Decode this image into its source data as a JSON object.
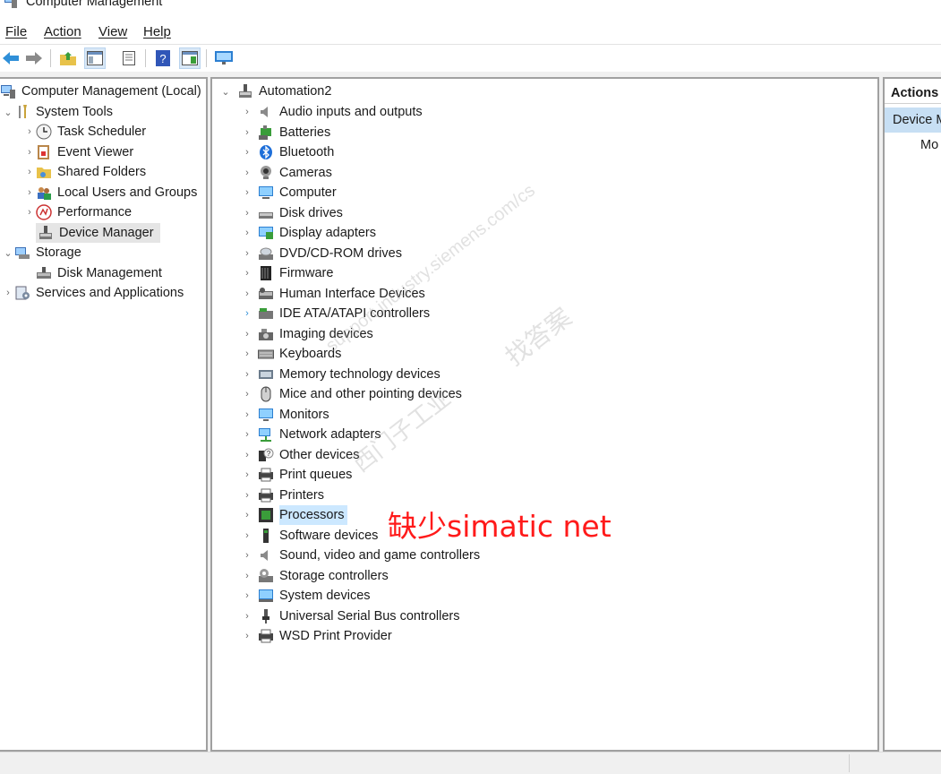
{
  "window": {
    "title": "Computer Management"
  },
  "menu": [
    "File",
    "Action",
    "View",
    "Help"
  ],
  "toolbar": [
    "back-icon",
    "forward-icon",
    "up-folder-icon",
    "show-hide-tree-icon",
    "properties-icon",
    "help-icon",
    "action-pane-icon",
    "monitor-icon"
  ],
  "tree": {
    "root": "Computer Management (Local)",
    "items": [
      {
        "label": "System Tools",
        "icon": "tools-icon"
      },
      {
        "label": "Task Scheduler",
        "icon": "clock-icon"
      },
      {
        "label": "Event Viewer",
        "icon": "event-viewer-icon"
      },
      {
        "label": "Shared Folders",
        "icon": "shared-folder-icon"
      },
      {
        "label": "Local Users and Groups",
        "icon": "users-icon"
      },
      {
        "label": "Performance",
        "icon": "performance-icon"
      },
      {
        "label": "Device Manager",
        "icon": "device-manager-icon"
      },
      {
        "label": "Storage",
        "icon": "storage-icon"
      },
      {
        "label": "Disk Management",
        "icon": "disk-icon"
      },
      {
        "label": "Services and Applications",
        "icon": "services-icon"
      }
    ]
  },
  "devices": {
    "root": "Automation2",
    "categories": [
      "Audio inputs and outputs",
      "Batteries",
      "Bluetooth",
      "Cameras",
      "Computer",
      "Disk drives",
      "Display adapters",
      "DVD/CD-ROM drives",
      "Firmware",
      "Human Interface Devices",
      "IDE ATA/ATAPI controllers",
      "Imaging devices",
      "Keyboards",
      "Memory technology devices",
      "Mice and other pointing devices",
      "Monitors",
      "Network adapters",
      "Other devices",
      "Print queues",
      "Printers",
      "Processors",
      "Software devices",
      "Sound, video and game controllers",
      "Storage controllers",
      "System devices",
      "Universal Serial Bus controllers",
      "WSD Print Provider"
    ]
  },
  "actions": {
    "header": "Actions",
    "item": "Device M",
    "more": "Mo"
  },
  "annotation": "缺少simatic net",
  "watermark": {
    "line1": "support.industry.siemens.com/cs",
    "line2": "找答案",
    "line3": "西门子工业"
  },
  "colors": {
    "accent_selected": "#c7dff4",
    "annotation": "#ff1a1a"
  }
}
